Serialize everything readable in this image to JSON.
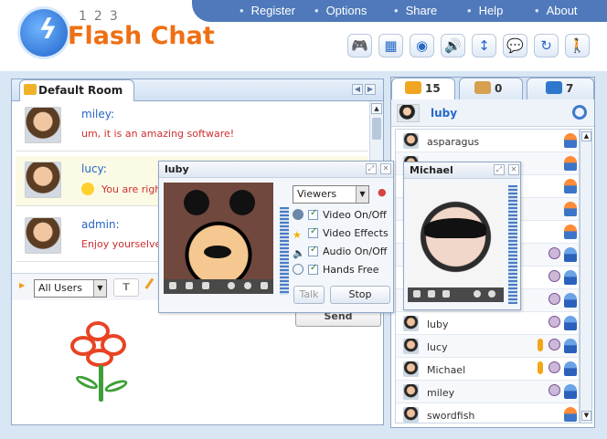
{
  "brand": {
    "number": "123",
    "name": "Flash Chat"
  },
  "nav": [
    "Register",
    "Options",
    "Share",
    "Help",
    "About"
  ],
  "toolbar": [
    "gamepad-icon",
    "window-icon",
    "webcam-icon",
    "sound-icon",
    "resize-icon",
    "chat-bubble-icon",
    "refresh-icon",
    "walk-icon"
  ],
  "room": {
    "title": "Default Room"
  },
  "messages": [
    {
      "user": "miley:",
      "text": "um, it is an amazing software!"
    },
    {
      "user": "lucy:",
      "text": "You are right"
    },
    {
      "user": "admin:",
      "text": "Enjoy yourselves,"
    }
  ],
  "input": {
    "recipient": "All Users",
    "send_label": "Send"
  },
  "user_tabs": [
    {
      "count": "15"
    },
    {
      "count": "0"
    },
    {
      "count": "7"
    }
  ],
  "me": {
    "name": "luby"
  },
  "users": [
    {
      "name": "asparagus",
      "status": "orange"
    },
    {
      "name": "",
      "status": "orange"
    },
    {
      "name": "",
      "status": "orange"
    },
    {
      "name": "",
      "status": "orange"
    },
    {
      "name": "",
      "status": "orange"
    },
    {
      "name": "",
      "status": "blue"
    },
    {
      "name": "",
      "status": "blue"
    },
    {
      "name": "",
      "status": "blue"
    },
    {
      "name": "luby",
      "status": "blue"
    },
    {
      "name": "lucy",
      "status": "blue"
    },
    {
      "name": "Michael",
      "status": "blue"
    },
    {
      "name": "miley",
      "status": "blue"
    },
    {
      "name": "swordfish",
      "status": "orange"
    }
  ],
  "video_luby": {
    "title": "luby",
    "viewers": "Viewers",
    "options": [
      "Video On/Off",
      "Video Effects",
      "Audio On/Off",
      "Hands Free"
    ],
    "talk": "Talk",
    "stop": "Stop"
  },
  "video_michael": {
    "title": "Michael"
  },
  "colors": {
    "brand": "#ef6f14",
    "nav": "#4f79ba",
    "link": "#2564c7",
    "message": "#ce2f2f"
  }
}
